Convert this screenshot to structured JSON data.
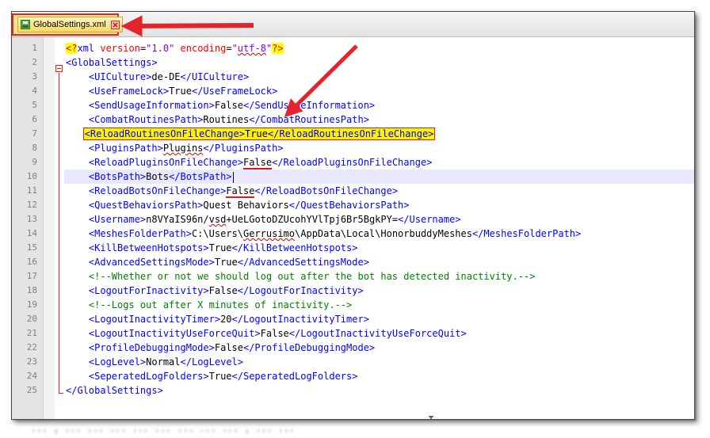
{
  "background_text": "... , ... ... ... ... ... ... ... ... , ... ...",
  "tab": {
    "title": "GlobalSettings.xml",
    "icon": "xml-file-icon",
    "close_icon": "close-tab-icon"
  },
  "line_numbers": [
    "1",
    "2",
    "3",
    "4",
    "5",
    "6",
    "7",
    "8",
    "9",
    "10",
    "11",
    "12",
    "13",
    "14",
    "15",
    "16",
    "17",
    "18",
    "19",
    "20",
    "21",
    "22",
    "23",
    "24",
    "25"
  ],
  "lines": {
    "l1": {
      "open": "<?",
      "xml": "xml ",
      "a1": "version",
      "eq1": "=",
      "v1": "\"1.0\"",
      "sp": " ",
      "a2": "encoding",
      "eq2": "=",
      "v2a": "\"",
      "v2b": "utf-8",
      "v2c": "\"",
      "close": "?>"
    },
    "l2": {
      "open": "<GlobalSettings>"
    },
    "l3": {
      "open": "<UICulture>",
      "value": "de-DE",
      "close": "</UICulture>"
    },
    "l4": {
      "open": "<UseFrameLock>",
      "value": "True",
      "close": "</UseFrameLock>"
    },
    "l5": {
      "open": "<SendUsageInformation>",
      "value": "False",
      "close": "</SendUsageInformation>"
    },
    "l6": {
      "open": "<CombatRoutinesPath>",
      "value": "Routines",
      "close": "</CombatRoutinesPath>"
    },
    "l7": {
      "open": "<ReloadRoutinesOnFileChange>",
      "value": "True",
      "close": "</ReloadRoutinesOnFileChange>"
    },
    "l8": {
      "open": "<PluginsPath>",
      "value": "Plugins",
      "close": "</PluginsPath>"
    },
    "l9": {
      "open": "<ReloadPluginsOnFileChange>",
      "value": "False",
      "close": "</ReloadPluginsOnFileChange>"
    },
    "l10": {
      "open": "<BotsPath>",
      "value": "Bots",
      "close": "</BotsPath>"
    },
    "l11": {
      "open": "<ReloadBotsOnFileChange>",
      "value": "False",
      "close": "</ReloadBotsOnFileChange>"
    },
    "l12": {
      "open": "<QuestBehaviorsPath>",
      "value": "Quest Behaviors",
      "close": "</QuestBehaviorsPath>"
    },
    "l13": {
      "open": "<Username>",
      "value_a": "n8VYaIS96n/",
      "value_b": "vsd",
      "value_c": "+UeLGotoDZUcohYVlTpj6Br5BgkPY=",
      "close": "</Username>"
    },
    "l14": {
      "open": "<MeshesFolderPath>",
      "value_a": "C:\\Users\\",
      "value_b": "Gerrusimo",
      "value_c": "\\AppData\\Local\\HonorbuddyMeshes",
      "close": "</MeshesFolderPath>"
    },
    "l15": {
      "open": "<KillBetweenHotspots>",
      "value": "True",
      "close": "</KillBetweenHotspots>"
    },
    "l16": {
      "open": "<AdvancedSettingsMode>",
      "value": "True",
      "close": "</AdvancedSettingsMode>"
    },
    "l17": {
      "comment": "<!--Whether or not we should log out after the bot has detected inactivity.-->"
    },
    "l18": {
      "open": "<LogoutForInactivity>",
      "value": "False",
      "close": "</LogoutForInactivity>"
    },
    "l19": {
      "comment": "<!--Logs out after X minutes of inactivity.-->"
    },
    "l20": {
      "open": "<LogoutInactivityTimer>",
      "value": "20",
      "close": "</LogoutInactivityTimer>"
    },
    "l21": {
      "open": "<LogoutInactivityUseForceQuit>",
      "value": "False",
      "close": "</LogoutInactivityUseForceQuit>"
    },
    "l22": {
      "open": "<ProfileDebuggingMode>",
      "value": "False",
      "close": "</ProfileDebuggingMode>"
    },
    "l23": {
      "open": "<LogLevel>",
      "value": "Normal",
      "close": "</LogLevel>"
    },
    "l24": {
      "open": "<SeperatedLogFolders>",
      "value": "True",
      "close": "</SeperatedLogFolders>"
    },
    "l25": {
      "close": "</GlobalSettings>"
    }
  },
  "colors": {
    "tag": "#0000ff",
    "comment": "#008000",
    "annotation_red": "#e5232a",
    "highlight_yellow": "#fff200",
    "current_line": "#e8e8ff"
  },
  "icons": [
    "xml-file-icon",
    "close-tab-icon",
    "fold-minus-icon",
    "text-cursor-icon",
    "annotation-arrow"
  ]
}
